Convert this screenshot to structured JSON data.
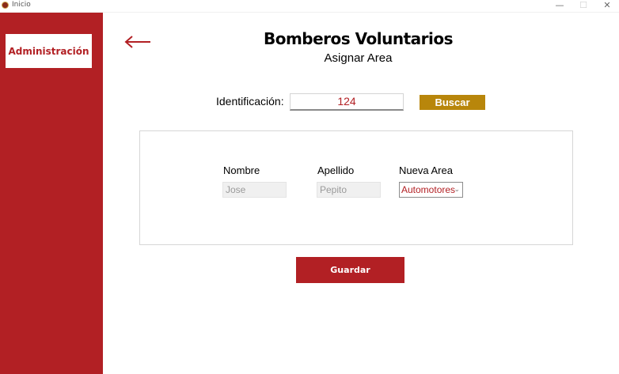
{
  "window": {
    "title": "Inicio",
    "minimize_glyph": "—",
    "maximize_glyph": "☐",
    "close_glyph": "✕"
  },
  "sidebar": {
    "items": [
      {
        "label": "Administración",
        "active": true
      }
    ]
  },
  "header": {
    "title": "Bomberos Voluntarios",
    "subtitle": "Asignar Area"
  },
  "search": {
    "label": "Identificación:",
    "value": "124",
    "button_label": "Buscar"
  },
  "form": {
    "nombre_label": "Nombre",
    "nombre_value": "Jose",
    "apellido_label": "Apellido",
    "apellido_value": "Pepito",
    "area_label": "Nueva Area",
    "area_selected": "Automotores"
  },
  "actions": {
    "save_label": "Guardar"
  },
  "icons": {
    "app": "app-logo-icon",
    "back": "back-arrow-icon",
    "dropdown": "chevron-down-icon"
  },
  "colors": {
    "primary": "#b22024",
    "accent": "#b8860b",
    "readonly_bg": "#f0f0f0"
  }
}
